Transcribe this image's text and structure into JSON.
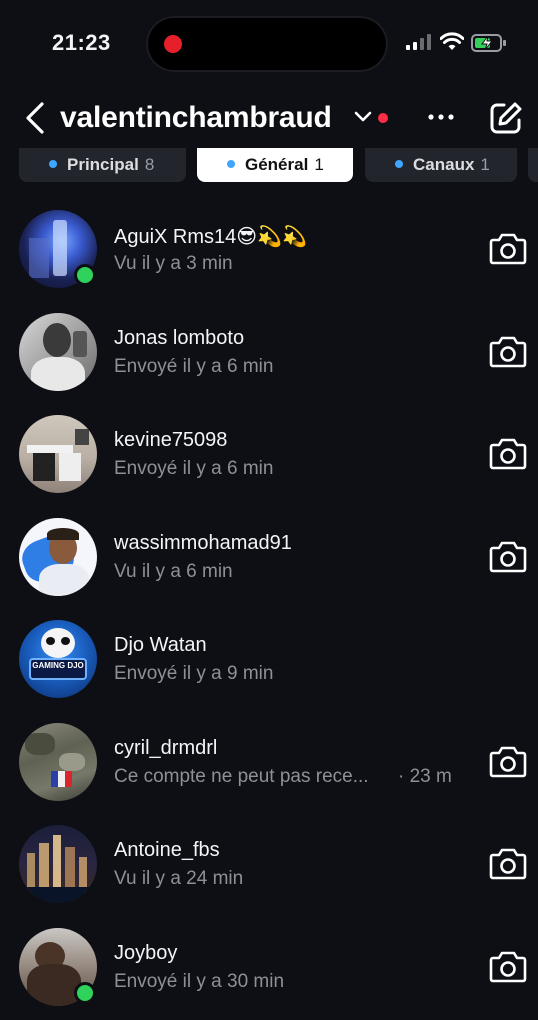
{
  "status_bar": {
    "time": "21:23",
    "battery_charging": true
  },
  "header": {
    "username": "valentinchambraud",
    "notification_dot_color": "#ff2e45"
  },
  "tabs": [
    {
      "label": "Principal",
      "count": "8",
      "active": false
    },
    {
      "label": "Général",
      "count": "1",
      "active": true
    },
    {
      "label": "Canaux",
      "count": "1",
      "active": false
    }
  ],
  "conversations": [
    {
      "name": "AguiX Rms14😎💫💫",
      "subtitle": "Vu il y a 3 min",
      "online": true,
      "has_camera": true
    },
    {
      "name": "Jonas lomboto",
      "subtitle": "Envoyé il y a 6 min",
      "online": false,
      "has_camera": true
    },
    {
      "name": "kevine75098",
      "subtitle": "Envoyé il y a 6 min",
      "online": false,
      "has_camera": true
    },
    {
      "name": "wassimmohamad91",
      "subtitle": "Vu il y a 6 min",
      "online": false,
      "has_camera": true
    },
    {
      "name": "Djo Watan",
      "subtitle": "Envoyé il y a 9 min",
      "online": false,
      "has_camera": false,
      "avatar_text": "GAMING DJO"
    },
    {
      "name": "cyril_drmdrl",
      "subtitle": "Ce compte ne peut pas rece...",
      "time": "· 23 m",
      "online": false,
      "has_camera": true
    },
    {
      "name": "Antoine_fbs",
      "subtitle": "Vu il y a 24 min",
      "online": false,
      "has_camera": true
    },
    {
      "name": "Joyboy",
      "subtitle": "Envoyé il y a 30 min",
      "online": true,
      "has_camera": true
    }
  ]
}
